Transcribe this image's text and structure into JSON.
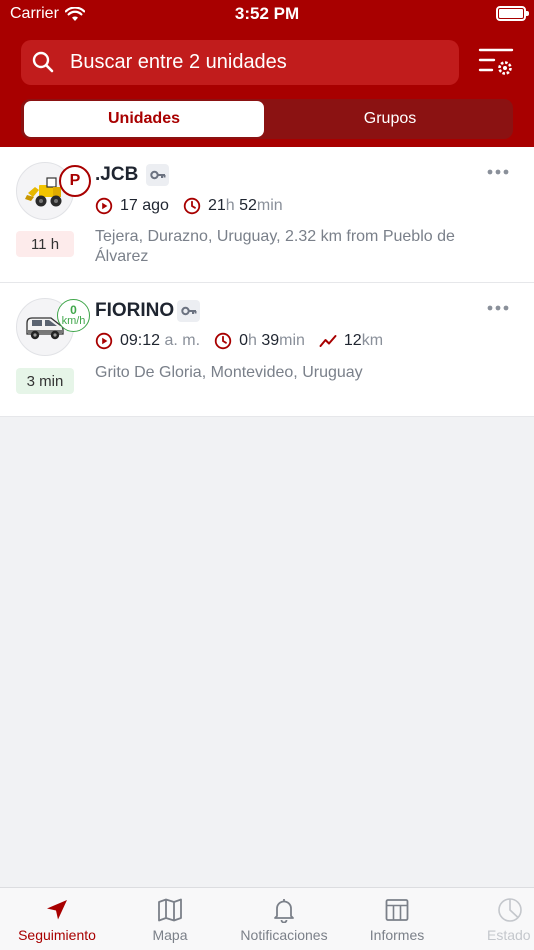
{
  "status_bar": {
    "carrier": "Carrier",
    "time": "3:52 PM"
  },
  "search": {
    "placeholder": "Buscar entre 2 unidades"
  },
  "segments": [
    {
      "label": "Unidades",
      "active": true
    },
    {
      "label": "Grupos",
      "active": false
    }
  ],
  "units": [
    {
      "name": ".JCB",
      "status_badge": "P",
      "age": "11 h",
      "last_msg": "17 ago",
      "duration_h": "21",
      "h_unit": "h",
      "duration_m": "52",
      "m_unit": "min",
      "address": "Tejera, Durazno, Uruguay, 2.32 km from Pueblo de Álvarez",
      "icon": "loader-icon"
    },
    {
      "name": "FIORINO",
      "speed_value": "0",
      "speed_unit": "km/h",
      "age": "3 min",
      "last_msg_time": "09:12",
      "last_msg_ampm": "a. m.",
      "duration_h": "0",
      "h_unit": "h",
      "duration_m": "39",
      "m_unit": "min",
      "distance": "12",
      "distance_unit": "km",
      "address": "Grito De Gloria, Montevideo, Uruguay",
      "icon": "van-icon"
    }
  ],
  "tabs": [
    {
      "label": "Seguimiento",
      "icon": "navigation-arrow-icon",
      "active": true
    },
    {
      "label": "Mapa",
      "icon": "map-icon",
      "active": false
    },
    {
      "label": "Notificaciones",
      "icon": "bell-icon",
      "active": false
    },
    {
      "label": "Informes",
      "icon": "table-icon",
      "active": false
    },
    {
      "label": "Estado",
      "icon": "pie-icon",
      "active": false
    }
  ],
  "colors": {
    "brand": "#a80000",
    "moving": "#3fa64a",
    "muted": "#8a909a"
  }
}
